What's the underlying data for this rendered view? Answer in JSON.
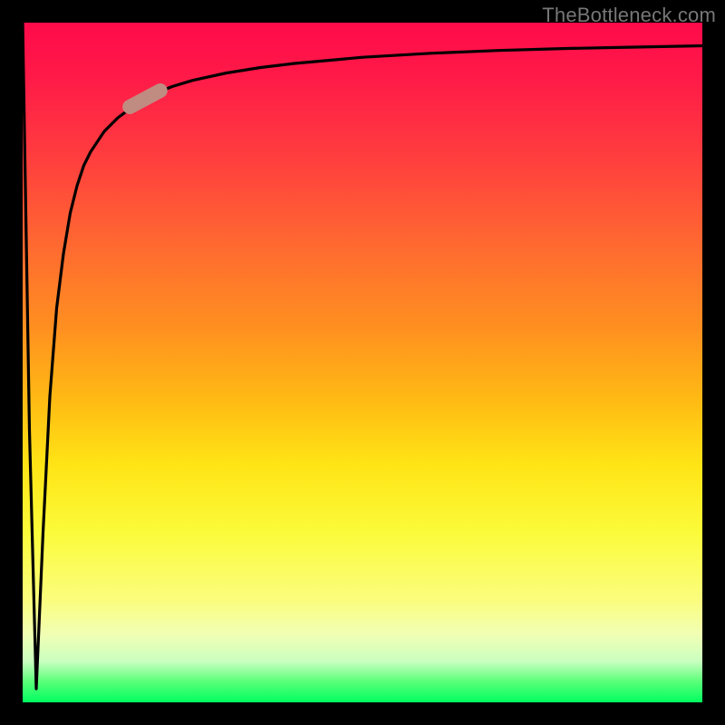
{
  "watermark": "TheBottleneck.com",
  "colors": {
    "gradient_top": "#ff0a4a",
    "gradient_bottom": "#00ff60",
    "curve": "#000000",
    "marker": "#c08c82",
    "frame": "#000000"
  },
  "chart_data": {
    "type": "line",
    "title": "",
    "xlabel": "",
    "ylabel": "",
    "xlim": [
      0,
      100
    ],
    "ylim": [
      0,
      100
    ],
    "grid": false,
    "series": [
      {
        "name": "bottleneck-curve",
        "x": [
          0,
          1,
          2,
          3,
          4,
          5,
          6,
          7,
          8,
          9,
          10,
          12,
          14,
          16,
          18,
          20,
          22,
          25,
          30,
          35,
          40,
          50,
          60,
          70,
          80,
          90,
          100
        ],
        "y": [
          100,
          40,
          2,
          25,
          45,
          58,
          66,
          72,
          76,
          79,
          81,
          84,
          86,
          87.5,
          88.8,
          89.8,
          90.6,
          91.5,
          92.6,
          93.4,
          94,
          94.9,
          95.5,
          95.9,
          96.2,
          96.4,
          96.6
        ]
      }
    ],
    "marker": {
      "x": 18,
      "y": 88.8,
      "angle_deg": -28
    }
  }
}
